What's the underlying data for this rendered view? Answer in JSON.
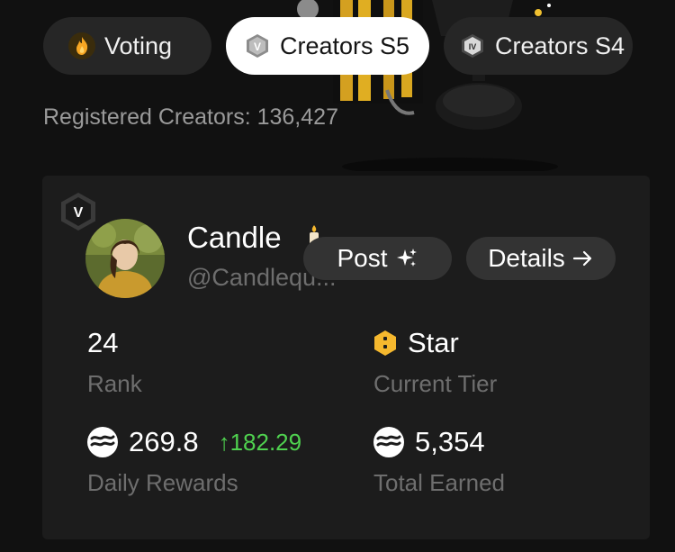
{
  "tabs": [
    {
      "label": "Voting",
      "icon": "flame-icon"
    },
    {
      "label": "Creators S5",
      "icon": "roman-v-badge-icon",
      "badge_text": "V"
    },
    {
      "label": "Creators S4",
      "icon": "roman-iv-badge-icon",
      "badge_text": "IV"
    }
  ],
  "registered_text": "Registered Creators: 136,427",
  "card": {
    "badge_text": "V",
    "name": "Candle",
    "handle": "@Candlequ...",
    "post_label": "Post",
    "details_label": "Details",
    "rank_value": "24",
    "rank_label": "Rank",
    "tier_value": "Star",
    "tier_label": "Current Tier",
    "daily_value": "269.8",
    "daily_delta": "182.29",
    "daily_label": "Daily Rewards",
    "total_value": "5,354",
    "total_label": "Total Earned"
  },
  "colors": {
    "background": "#111111",
    "card": "#1c1c1c",
    "delta_up": "#4fd14f",
    "tier_gold": "#f5b82e"
  }
}
